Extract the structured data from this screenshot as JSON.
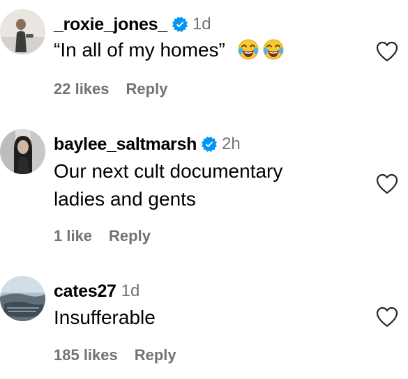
{
  "comments": [
    {
      "username": "_roxie_jones_",
      "verified": true,
      "time": "1d",
      "text_lines": [
        "“In all of my homes”"
      ],
      "emojis": [
        "face-with-tears-of-joy",
        "face-with-tears-of-joy"
      ],
      "likes": "22 likes",
      "reply": "Reply"
    },
    {
      "username": "baylee_saltmarsh",
      "verified": true,
      "time": "2h",
      "text_lines": [
        "Our next cult documentary",
        "ladies and gents"
      ],
      "likes": "1 like",
      "reply": "Reply"
    },
    {
      "username": "cates27",
      "verified": false,
      "time": "1d",
      "text_lines": [
        "Insufferable"
      ],
      "likes": "185 likes",
      "reply": "Reply"
    }
  ],
  "colors": {
    "text": "#000000",
    "secondary": "#737373",
    "verified_badge": "#0095f6"
  },
  "icons": {
    "verified": "verified-badge-icon",
    "like": "heart-outline-icon"
  }
}
